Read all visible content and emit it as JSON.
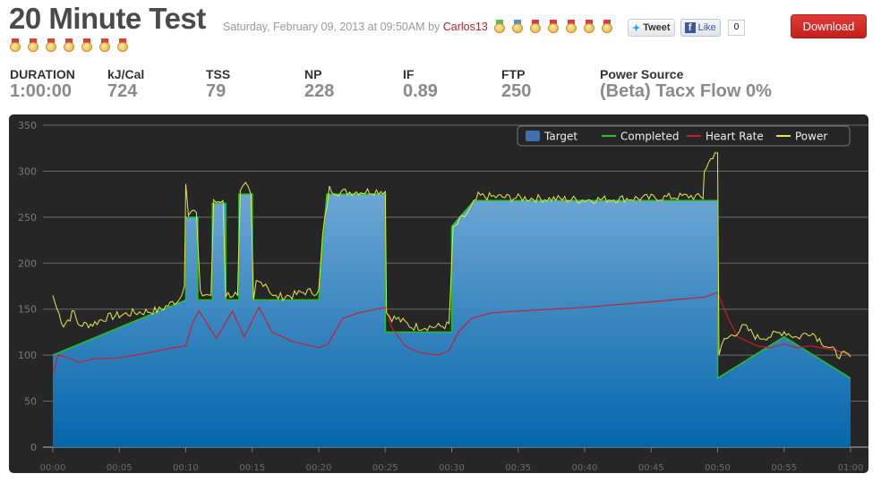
{
  "header": {
    "title": "20 Minute Test",
    "date": "Saturday, February 09, 2013 at 09:50AM by",
    "user": "Carlos13",
    "medals_row1": [
      "green",
      "blue",
      "red",
      "red",
      "red",
      "red",
      "red"
    ],
    "medals_row2": [
      "red",
      "red",
      "red",
      "red",
      "red",
      "red",
      "red"
    ]
  },
  "social": {
    "tweet": "Tweet",
    "like": "Like",
    "like_count": "0"
  },
  "download": "Download",
  "stats": [
    {
      "label": "DURATION",
      "value": "1:00:00"
    },
    {
      "label": "kJ/Cal",
      "value": "724"
    },
    {
      "label": "TSS",
      "value": "79"
    },
    {
      "label": "NP",
      "value": "228"
    },
    {
      "label": "IF",
      "value": "0.89"
    },
    {
      "label": "FTP",
      "value": "250"
    },
    {
      "label": "Power Source",
      "value": "(Beta) Tacx Flow 0%"
    }
  ],
  "chart_data": {
    "type": "area",
    "xlim": [
      0,
      60
    ],
    "ylim": [
      0,
      350
    ],
    "yticks": [
      0,
      50,
      100,
      150,
      200,
      250,
      300,
      350
    ],
    "xticks": [
      "00:00",
      "00:05",
      "00:10",
      "00:15",
      "00:20",
      "00:25",
      "00:30",
      "00:35",
      "00:40",
      "00:45",
      "00:50",
      "00:55",
      "01:00"
    ],
    "legend": [
      "Target",
      "Completed",
      "Heart Rate",
      "Power"
    ],
    "legend_position": "top-right",
    "colors": {
      "Target": "#3f85c0",
      "Completed": "#22c322",
      "Heart Rate": "#c42030",
      "Power": "#e8e84a"
    },
    "series": [
      {
        "name": "Target",
        "points": [
          [
            0,
            100
          ],
          [
            10,
            160
          ],
          [
            10,
            250
          ],
          [
            10.9,
            250
          ],
          [
            10.9,
            160
          ],
          [
            12,
            160
          ],
          [
            12,
            265
          ],
          [
            13,
            265
          ],
          [
            13,
            160
          ],
          [
            14,
            160
          ],
          [
            14,
            275
          ],
          [
            15,
            275
          ],
          [
            15,
            160
          ],
          [
            20,
            160
          ],
          [
            20.6,
            275
          ],
          [
            25,
            275
          ],
          [
            25,
            125
          ],
          [
            30,
            125
          ],
          [
            30,
            240
          ],
          [
            31.7,
            268
          ],
          [
            50,
            268
          ],
          [
            50,
            75
          ],
          [
            55,
            120
          ],
          [
            60,
            75
          ]
        ]
      },
      {
        "name": "Completed",
        "points": [
          [
            0,
            100
          ],
          [
            10,
            160
          ],
          [
            10,
            250
          ],
          [
            10.9,
            250
          ],
          [
            10.9,
            160
          ],
          [
            12,
            160
          ],
          [
            12,
            265
          ],
          [
            13,
            265
          ],
          [
            13,
            160
          ],
          [
            14,
            160
          ],
          [
            14,
            275
          ],
          [
            15,
            275
          ],
          [
            15,
            160
          ],
          [
            20,
            160
          ],
          [
            20.6,
            275
          ],
          [
            25,
            275
          ],
          [
            25,
            125
          ],
          [
            30,
            125
          ],
          [
            30,
            240
          ],
          [
            31.7,
            268
          ],
          [
            50,
            268
          ],
          [
            50,
            75
          ],
          [
            55,
            120
          ],
          [
            60,
            75
          ]
        ]
      },
      {
        "name": "Heart Rate",
        "points": [
          [
            0,
            80
          ],
          [
            0.4,
            100
          ],
          [
            1,
            98
          ],
          [
            2,
            92
          ],
          [
            3,
            96
          ],
          [
            5,
            97
          ],
          [
            7,
            102
          ],
          [
            9,
            108
          ],
          [
            10,
            110
          ],
          [
            10.5,
            135
          ],
          [
            11,
            148
          ],
          [
            12.3,
            118
          ],
          [
            13.5,
            148
          ],
          [
            14.4,
            120
          ],
          [
            15.5,
            152
          ],
          [
            16.5,
            125
          ],
          [
            18,
            115
          ],
          [
            20,
            108
          ],
          [
            20.7,
            112
          ],
          [
            21.8,
            140
          ],
          [
            23,
            146
          ],
          [
            25,
            152
          ],
          [
            25.5,
            130
          ],
          [
            26.5,
            110
          ],
          [
            27.5,
            103
          ],
          [
            29,
            100
          ],
          [
            29.8,
            105
          ],
          [
            30.5,
            125
          ],
          [
            31.5,
            140
          ],
          [
            33,
            146
          ],
          [
            35,
            148
          ],
          [
            40,
            152
          ],
          [
            45,
            158
          ],
          [
            49,
            163
          ],
          [
            50,
            168
          ],
          [
            50.8,
            140
          ],
          [
            51.5,
            120
          ],
          [
            53,
            110
          ],
          [
            54,
            108
          ],
          [
            55,
            112
          ],
          [
            56,
            108
          ],
          [
            57,
            110
          ],
          [
            59,
            105
          ],
          [
            60,
            100
          ]
        ]
      },
      {
        "name": "Power",
        "points": [
          [
            0,
            165
          ],
          [
            0.3,
            150
          ],
          [
            0.8,
            132
          ],
          [
            1.3,
            140
          ],
          [
            1.6,
            148
          ],
          [
            1.9,
            132
          ],
          [
            3,
            133
          ],
          [
            4,
            140
          ],
          [
            6,
            145
          ],
          [
            8,
            148
          ],
          [
            9.5,
            160
          ],
          [
            9.9,
            175
          ],
          [
            10,
            286
          ],
          [
            10.2,
            255
          ],
          [
            10.8,
            255
          ],
          [
            11.1,
            165
          ],
          [
            11.9,
            165
          ],
          [
            12.1,
            265
          ],
          [
            12.8,
            268
          ],
          [
            13,
            165
          ],
          [
            13.9,
            165
          ],
          [
            14.1,
            275
          ],
          [
            14.5,
            283
          ],
          [
            14.9,
            275
          ],
          [
            15.1,
            160
          ],
          [
            15.3,
            178
          ],
          [
            16,
            178
          ],
          [
            16.6,
            162
          ],
          [
            18,
            164
          ],
          [
            19,
            168
          ],
          [
            20,
            168
          ],
          [
            20.3,
            230
          ],
          [
            20.8,
            280
          ],
          [
            21.5,
            276
          ],
          [
            25,
            278
          ],
          [
            25.1,
            145
          ],
          [
            25.5,
            140
          ],
          [
            26,
            138
          ],
          [
            27,
            130
          ],
          [
            29,
            130
          ],
          [
            29.8,
            132
          ],
          [
            30.1,
            235
          ],
          [
            30.6,
            245
          ],
          [
            31.3,
            255
          ],
          [
            32,
            272
          ],
          [
            35,
            270
          ],
          [
            40,
            268
          ],
          [
            45,
            270
          ],
          [
            48,
            272
          ],
          [
            48.9,
            270
          ],
          [
            49,
            300
          ],
          [
            49.8,
            320
          ],
          [
            50,
            320
          ],
          [
            50.1,
            100
          ],
          [
            50.5,
            115
          ],
          [
            51.5,
            125
          ],
          [
            52,
            130
          ],
          [
            53,
            118
          ],
          [
            54,
            120
          ],
          [
            55,
            125
          ],
          [
            56,
            118
          ],
          [
            57,
            125
          ],
          [
            58,
            112
          ],
          [
            59,
            100
          ],
          [
            60,
            98
          ]
        ]
      }
    ]
  }
}
